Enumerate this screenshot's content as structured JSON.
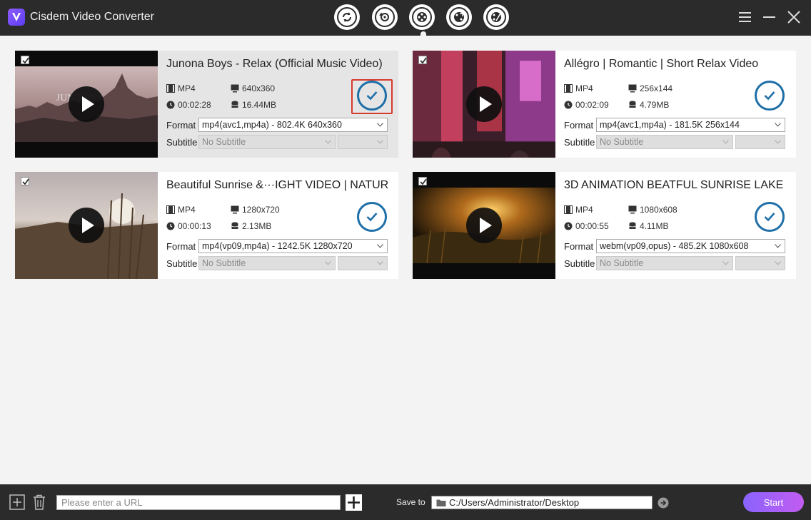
{
  "window": {
    "title": "Cisdem Video Converter"
  },
  "mode_tabs": [
    {
      "name": "convert"
    },
    {
      "name": "rip"
    },
    {
      "name": "download"
    },
    {
      "name": "compress"
    },
    {
      "name": "edit"
    }
  ],
  "videos": [
    {
      "title": "Junona Boys - Relax (Official Music Video)",
      "thumb_text": "JUN    BOYS",
      "format": "MP4",
      "resolution": "640x360",
      "duration": "00:02:28",
      "size": "16.44MB",
      "format_label": "Format",
      "format_option": "mp4(avc1,mp4a) - 802.4K 640x360",
      "subtitle_label": "Subtitle",
      "subtitle_option": "No Subtitle",
      "selected": true
    },
    {
      "title": "Allégro | Romantic | Short Relax Video",
      "thumb_text": "",
      "format": "MP4",
      "resolution": "256x144",
      "duration": "00:02:09",
      "size": "4.79MB",
      "format_label": "Format",
      "format_option": "mp4(avc1,mp4a) - 181.5K 256x144",
      "subtitle_label": "Subtitle",
      "subtitle_option": "No Subtitle",
      "selected": false
    },
    {
      "title": "Beautiful Sunrise &···IGHT VIDEO | NATURE",
      "thumb_text": "",
      "format": "MP4",
      "resolution": "1280x720",
      "duration": "00:00:13",
      "size": "2.13MB",
      "format_label": "Format",
      "format_option": "mp4(vp09,mp4a) - 1242.5K 1280x720",
      "subtitle_label": "Subtitle",
      "subtitle_option": "No Subtitle",
      "selected": false
    },
    {
      "title": "3D ANIMATION BEATFUL SUNRISE LAKE",
      "thumb_text": "",
      "format": "MP4",
      "resolution": "1080x608",
      "duration": "00:00:55",
      "size": "4.11MB",
      "format_label": "Format",
      "format_option": "webm(vp09,opus) - 485.2K 1080x608",
      "subtitle_label": "Subtitle",
      "subtitle_option": "No Subtitle",
      "selected": false
    }
  ],
  "bottom": {
    "url_placeholder": "Please enter a URL",
    "save_to_label": "Save to",
    "save_path": "C:/Users/Administrator/Desktop",
    "start_label": "Start"
  },
  "colors": {
    "titlebar": "#2b2b2b",
    "accent_check": "#1f6fa8",
    "highlight": "#d63b2f",
    "start_gradient": [
      "#8a63ff",
      "#c25cf0"
    ]
  }
}
